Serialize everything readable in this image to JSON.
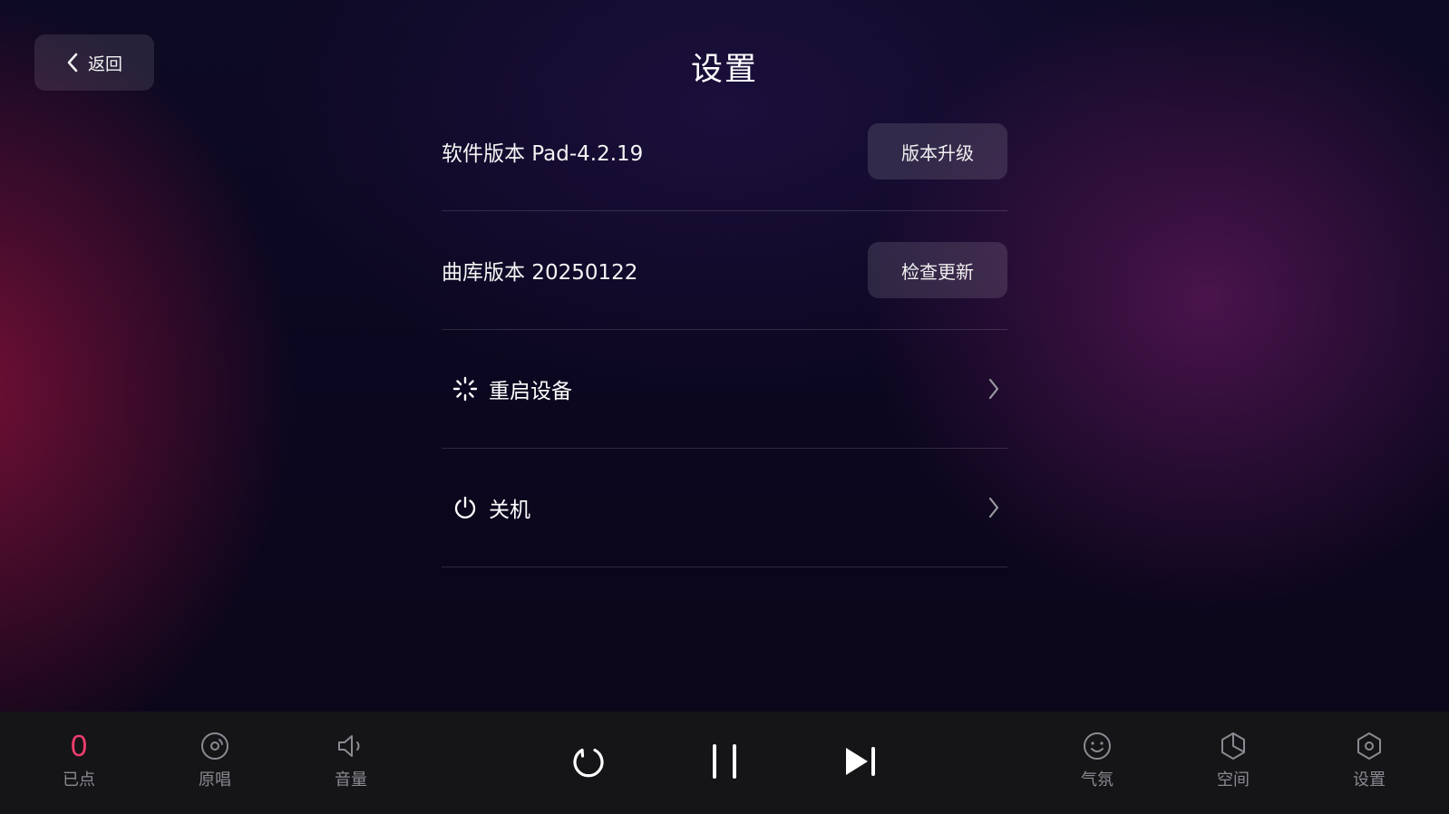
{
  "header": {
    "back_label": "返回",
    "title": "设置"
  },
  "settings": {
    "software_version": "软件版本 Pad-4.2.19",
    "upgrade_button": "版本升级",
    "library_version": "曲库版本 20250122",
    "check_update_button": "检查更新",
    "restart_label": "重启设备",
    "shutdown_label": "关机"
  },
  "bottom_bar": {
    "queued_count": "0",
    "queued_label": "已点",
    "original_label": "原唱",
    "volume_label": "音量",
    "atmosphere_label": "气氛",
    "space_label": "空间",
    "settings_label": "设置",
    "controls": [
      "replay-icon",
      "pause-icon",
      "next-track-icon"
    ]
  },
  "colors": {
    "accent": "#ee3d6e",
    "bar_background": "#151417",
    "muted_text": "#8a8a92"
  }
}
